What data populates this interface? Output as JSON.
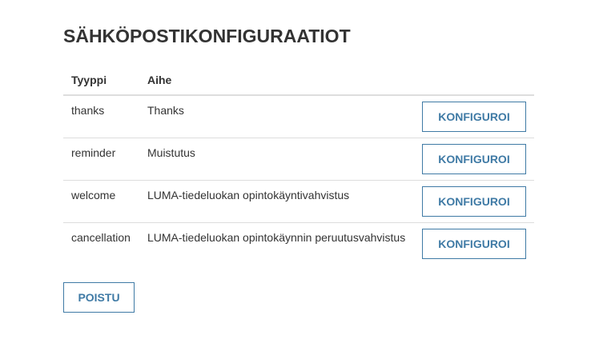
{
  "page": {
    "title": "SÄHKÖPOSTIKONFIGURAATIOT"
  },
  "table": {
    "headers": {
      "type": "Tyyppi",
      "subject": "Aihe",
      "action": ""
    },
    "rows": [
      {
        "type": "thanks",
        "subject": "Thanks",
        "action_label": "KONFIGUROI"
      },
      {
        "type": "reminder",
        "subject": "Muistutus",
        "action_label": "KONFIGUROI"
      },
      {
        "type": "welcome",
        "subject": "LUMA-tiedeluokan opintokäyntivahvistus",
        "action_label": "KONFIGUROI"
      },
      {
        "type": "cancellation",
        "subject": "LUMA-tiedeluokan opintokäynnin peruutusvahvistus",
        "action_label": "KONFIGUROI"
      }
    ]
  },
  "footer": {
    "exit_label": "POISTU"
  },
  "colors": {
    "accent": "#3f7aa5",
    "text": "#333333",
    "border": "#dddddd"
  }
}
